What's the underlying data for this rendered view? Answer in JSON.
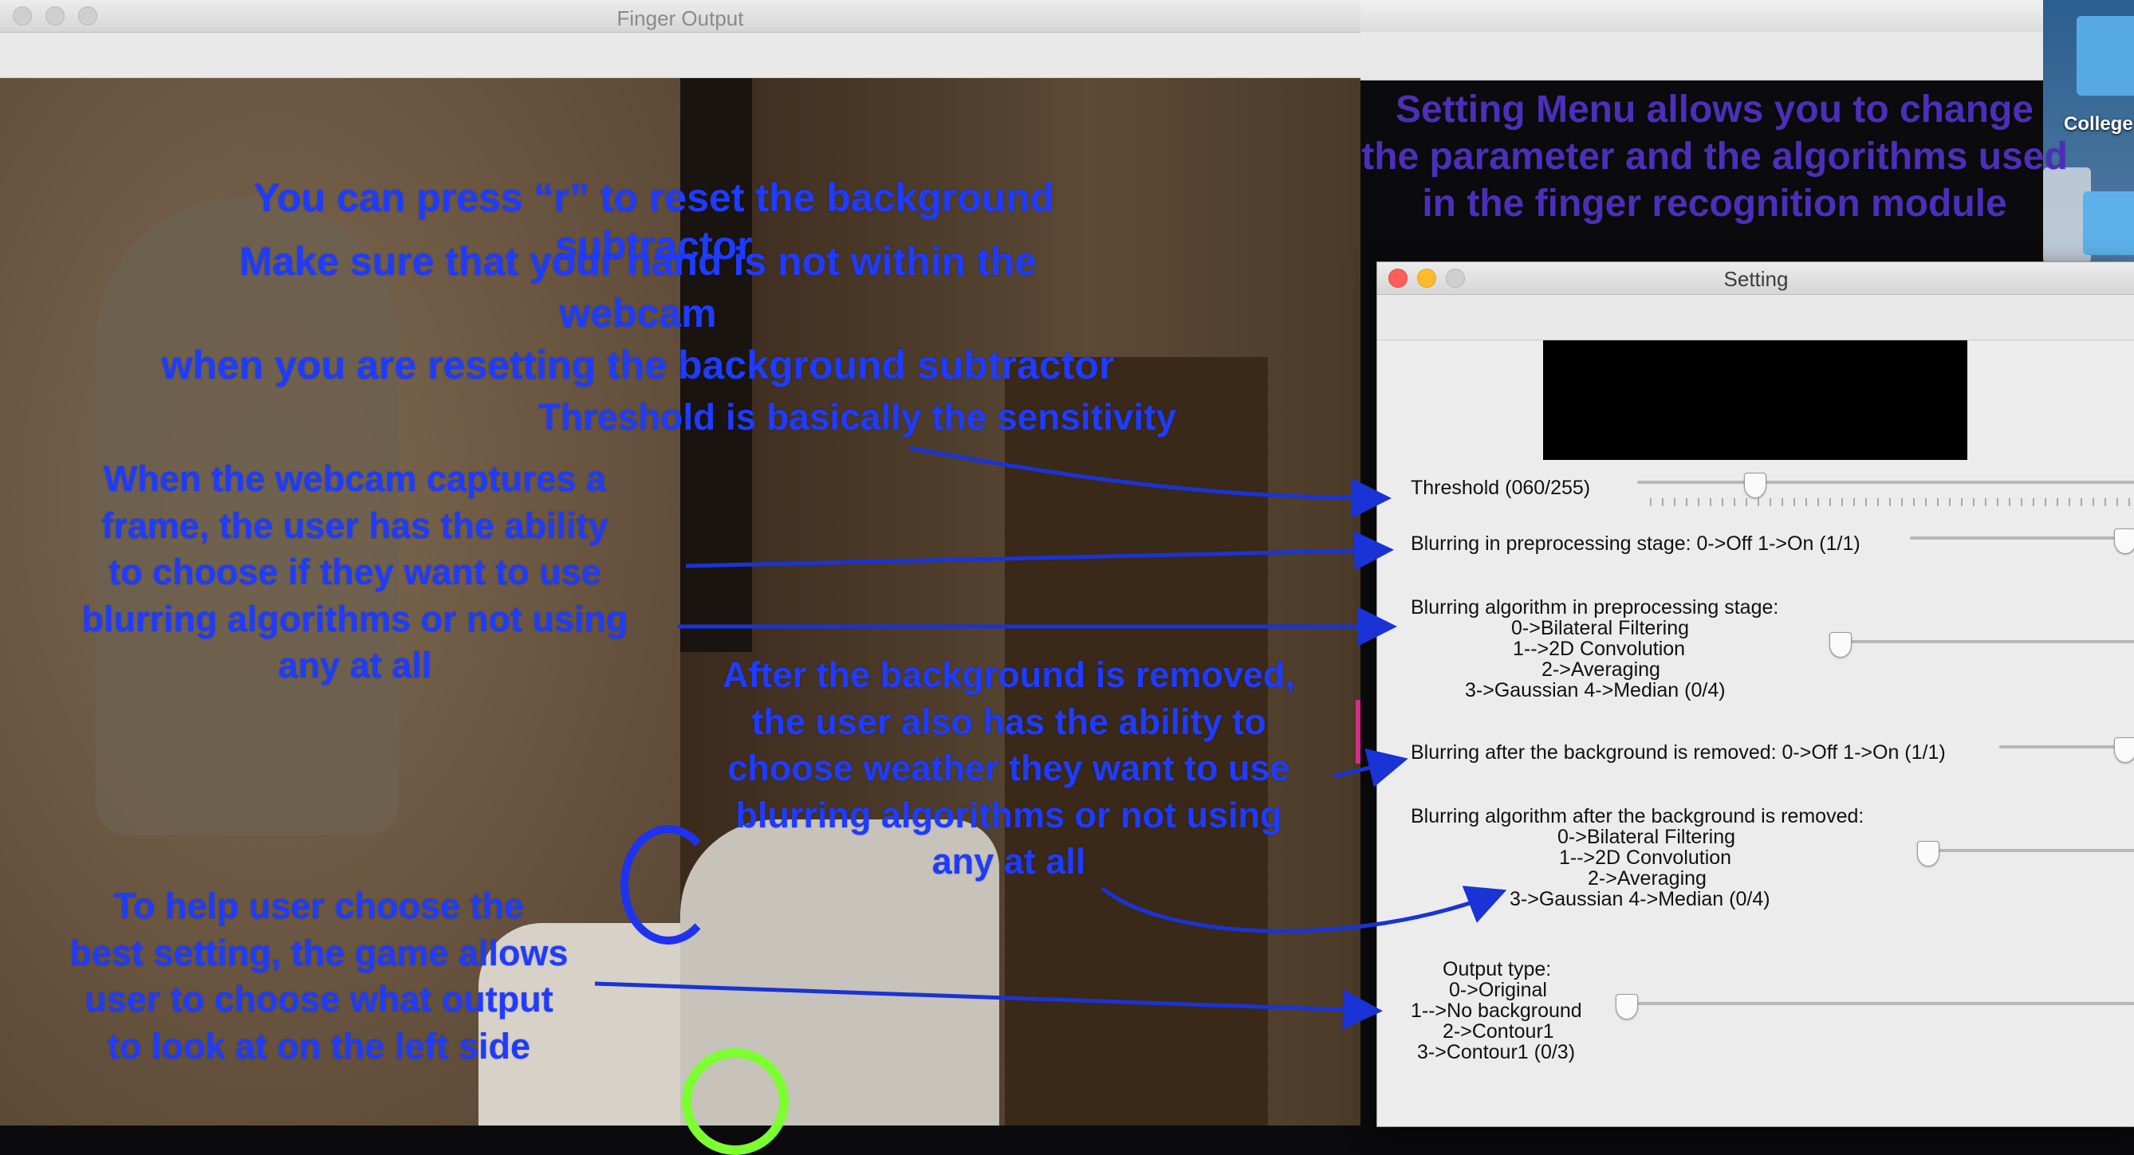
{
  "finger_window": {
    "title": "Finger Output"
  },
  "desktop": {
    "folder_label": "College"
  },
  "setting_window": {
    "title": "Setting",
    "threshold": {
      "label": "Threshold  (060/255)",
      "value": 60,
      "max": 255
    },
    "blur_pre": {
      "label": "Blurring in preprocessing stage: 0->Off 1->On (1/1)",
      "value": 1,
      "max": 1
    },
    "blur_pre_algo": {
      "lines": [
        "Blurring algorithm in preprocessing stage:",
        "0->Bilateral Filtering",
        "1-->2D Convolution",
        "2->Averaging",
        "3->Gaussian 4->Median (0/4)"
      ],
      "value": 0,
      "max": 4
    },
    "blur_post": {
      "label": "Blurring after the background is removed: 0->Off 1->On (1/1)",
      "value": 1,
      "max": 1
    },
    "blur_post_algo": {
      "lines": [
        "Blurring algorithm after the background is removed:",
        "0->Bilateral Filtering",
        "1-->2D Convolution",
        "2->Averaging",
        "3->Gaussian 4->Median (0/4)"
      ],
      "value": 0,
      "max": 4
    },
    "output_type": {
      "lines": [
        "Output type:",
        "0->Original",
        "1-->No background",
        "2->Contour1",
        "3->Contour1 (0/3)"
      ],
      "value": 0,
      "max": 3
    }
  },
  "annotations": {
    "setting_menu": [
      "Setting Menu allows you to change",
      "the parameter and the algorithms used",
      "in the finger recognition module"
    ],
    "reset": "You can press “r” to reset the background subtractor",
    "hand_warning": [
      "Make sure that your hand is not within the webcam",
      "when you are resetting the background subtractor"
    ],
    "threshold": "Threshold is basically the sensitivity",
    "blurring_pre": [
      "When the webcam captures a",
      "frame, the user has the ability",
      "to choose if they want to use",
      "blurring algorithms or not using",
      "any at all"
    ],
    "blurring_post": [
      "After the background is removed,",
      "the user also has the ability to",
      "choose weather they want to use",
      "blurring algorithms or not using",
      "any at all"
    ],
    "output": [
      "To help user choose the",
      "best setting, the game allows",
      "user to choose what output",
      "to look at on the left side"
    ]
  },
  "colors": {
    "annotation_blue": "#1f3bff",
    "annotation_purple": "#4c2fb8",
    "arrow_blue": "#1a33d6",
    "close": "#fc5f57",
    "minimize": "#fdbc2e",
    "inactive_light": "#cfcfcf"
  }
}
